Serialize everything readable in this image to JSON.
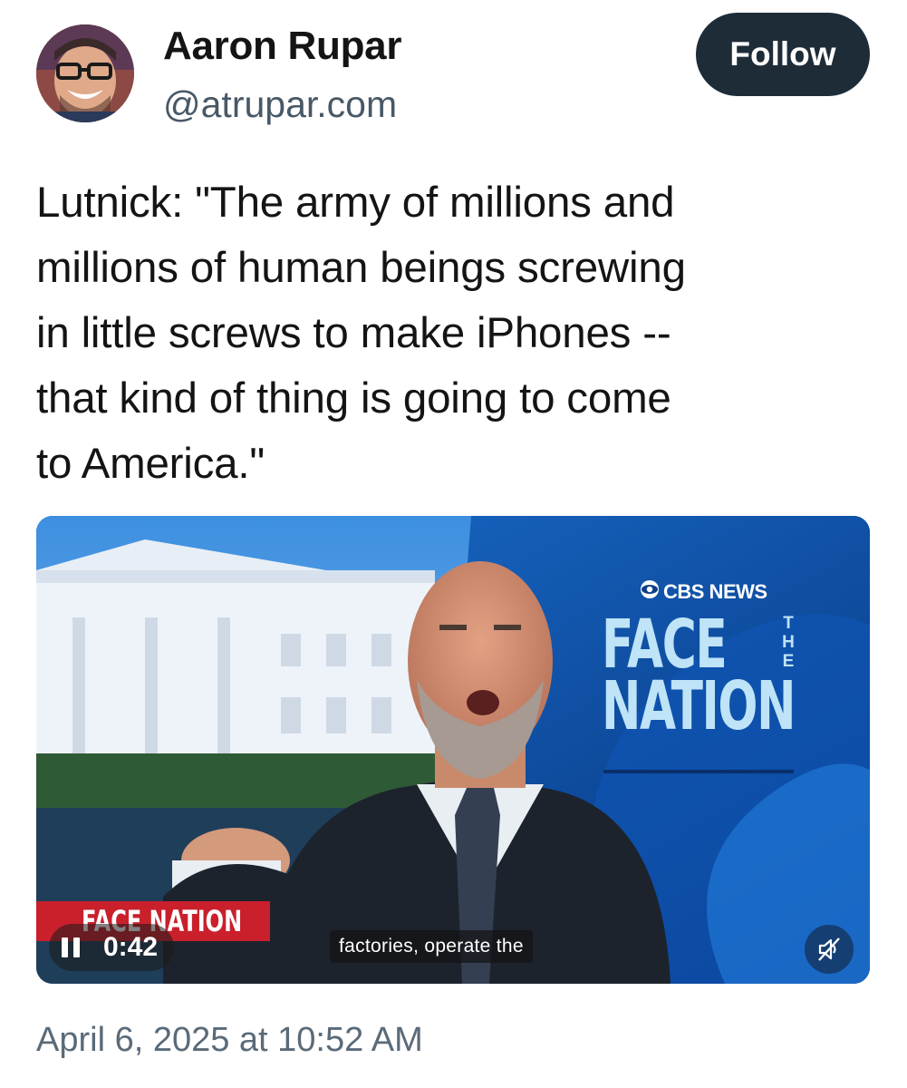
{
  "author": {
    "name": "Aaron Rupar",
    "handle": "@atrupar.com"
  },
  "follow_label": "Follow",
  "post_text": "Lutnick: \"The army of millions and\nmillions of human beings screwing\nin little screws to make iPhones --\nthat kind of thing is going to come\nto America.\"",
  "video": {
    "network_label": "CBS NEWS",
    "show_name": "FACE\nNATION",
    "show_the": "THE",
    "lower_third": "FACE NATION",
    "elapsed_time": "0:42",
    "caption": "factories, operate the",
    "playing": true,
    "muted": true
  },
  "timestamp": "April 6, 2025 at 10:52 AM",
  "colors": {
    "follow_button_bg": "#1e2c38",
    "handle_text": "#485866",
    "studio_blue": "#0d3e86",
    "badge_red": "#c9202c"
  },
  "icons": {
    "pause": "pause-icon",
    "mute": "speaker-muted-icon",
    "network": "cbs-eye-icon"
  }
}
